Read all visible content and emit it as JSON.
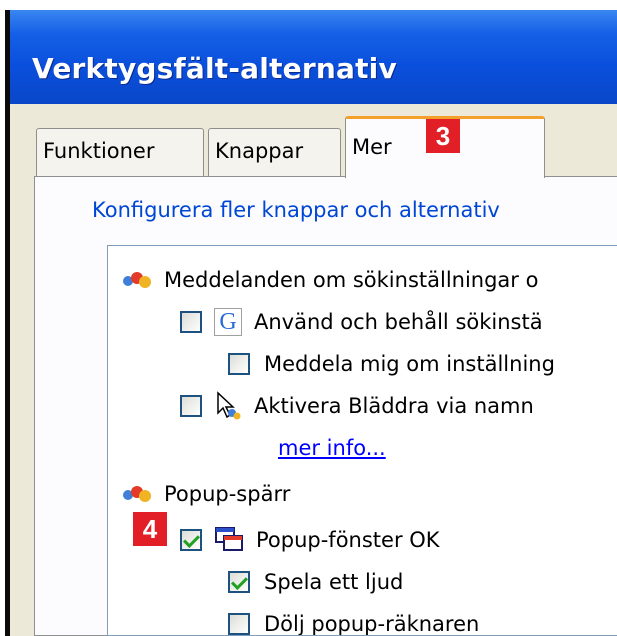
{
  "window": {
    "title": "Verktygsfält-alternativ"
  },
  "tabs": [
    {
      "label": "Funktioner",
      "active": false
    },
    {
      "label": "Knappar",
      "active": false
    },
    {
      "label": "Mer",
      "active": true
    }
  ],
  "badges": {
    "tab_marker": "3",
    "popup_marker": "4",
    "color": "#e21f26"
  },
  "group": {
    "title": "Konfigurera fler knappar och alternativ"
  },
  "list": {
    "section_notifications": {
      "label": "Meddelanden om sökinställningar o",
      "icon": "options-category-icon"
    },
    "items_notifications": [
      {
        "label": "Använd och behåll sökinstä",
        "checked": false,
        "icon": "google-g-icon"
      },
      {
        "label": "Meddela mig om inställning",
        "checked": false
      },
      {
        "label": "Aktivera Bläddra via namn",
        "checked": false,
        "icon": "browse-by-name-icon"
      }
    ],
    "more_info_link": "mer info...",
    "section_popup": {
      "label": "Popup-spärr",
      "icon": "options-category-icon"
    },
    "items_popup": [
      {
        "label": "Popup-fönster OK",
        "checked": true,
        "icon": "popup-windows-icon"
      },
      {
        "label": "Spela ett ljud",
        "checked": true
      },
      {
        "label": "Dölj popup-räknaren",
        "checked": false
      }
    ]
  },
  "colors": {
    "titlebar": "#0a4fdc",
    "active_tab_highlight": "#f3a12b",
    "group_title": "#0046d5",
    "link": "#0000ff",
    "check": "#21a121"
  }
}
